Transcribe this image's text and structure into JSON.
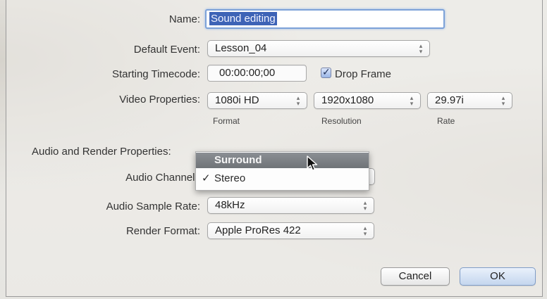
{
  "form": {
    "name_label": "Name:",
    "name_value": "Sound editing",
    "default_event_label": "Default Event:",
    "default_event_value": "Lesson_04",
    "starting_timecode_label": "Starting Timecode:",
    "starting_timecode_value": "00:00:00;00",
    "drop_frame_label": "Drop Frame",
    "drop_frame_checked": true,
    "video_properties_label": "Video Properties:",
    "video_format_value": "1080i HD",
    "video_format_caption": "Format",
    "video_resolution_value": "1920x1080",
    "video_resolution_caption": "Resolution",
    "video_rate_value": "29.97i",
    "video_rate_caption": "Rate",
    "audio_render_properties_label": "Audio and Render Properties:",
    "audio_channels_label": "Audio Channels",
    "audio_sample_rate_label": "Audio Sample Rate:",
    "audio_sample_rate_value": "48kHz",
    "render_format_label": "Render Format:",
    "render_format_value": "Apple ProRes 422"
  },
  "audio_channels_menu": {
    "items": [
      {
        "label": "Surround",
        "highlighted": true,
        "checked": false
      },
      {
        "label": "Stereo",
        "highlighted": false,
        "checked": true
      }
    ],
    "check_glyph": "✓"
  },
  "buttons": {
    "cancel_label": "Cancel",
    "ok_label": "OK"
  },
  "icons": {
    "stepper": "updown-arrows-icon",
    "checkmark": "checkmark-icon",
    "pointer": "arrow-cursor-icon"
  },
  "colors": {
    "selection": "#3d63b6",
    "focus_ring": "#7da2d8",
    "menu_highlight": "#7d8186"
  }
}
